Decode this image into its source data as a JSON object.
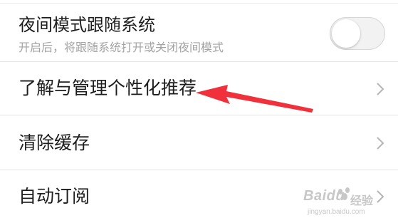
{
  "settings": {
    "night_mode": {
      "title": "夜间模式跟随系统",
      "subtitle": "开启后，将跟随系统打开或关闭夜间模式",
      "toggle_on": false
    },
    "personalization": {
      "title": "了解与管理个性化推荐"
    },
    "clear_cache": {
      "title": "清除缓存"
    },
    "auto_subscribe": {
      "title": "自动订阅"
    }
  },
  "icons": {
    "chevron": "chevron-right-icon",
    "annotation": "red-arrow-icon"
  },
  "colors": {
    "annotation_arrow": "#f0303a",
    "toggle_track": "#f2f2f2",
    "divider": "#e6e6e6",
    "subtitle": "#a3a3a3"
  },
  "watermark": {
    "brand": "Baidu",
    "suffix": "经验",
    "site": "jingyan.baidu.com"
  }
}
